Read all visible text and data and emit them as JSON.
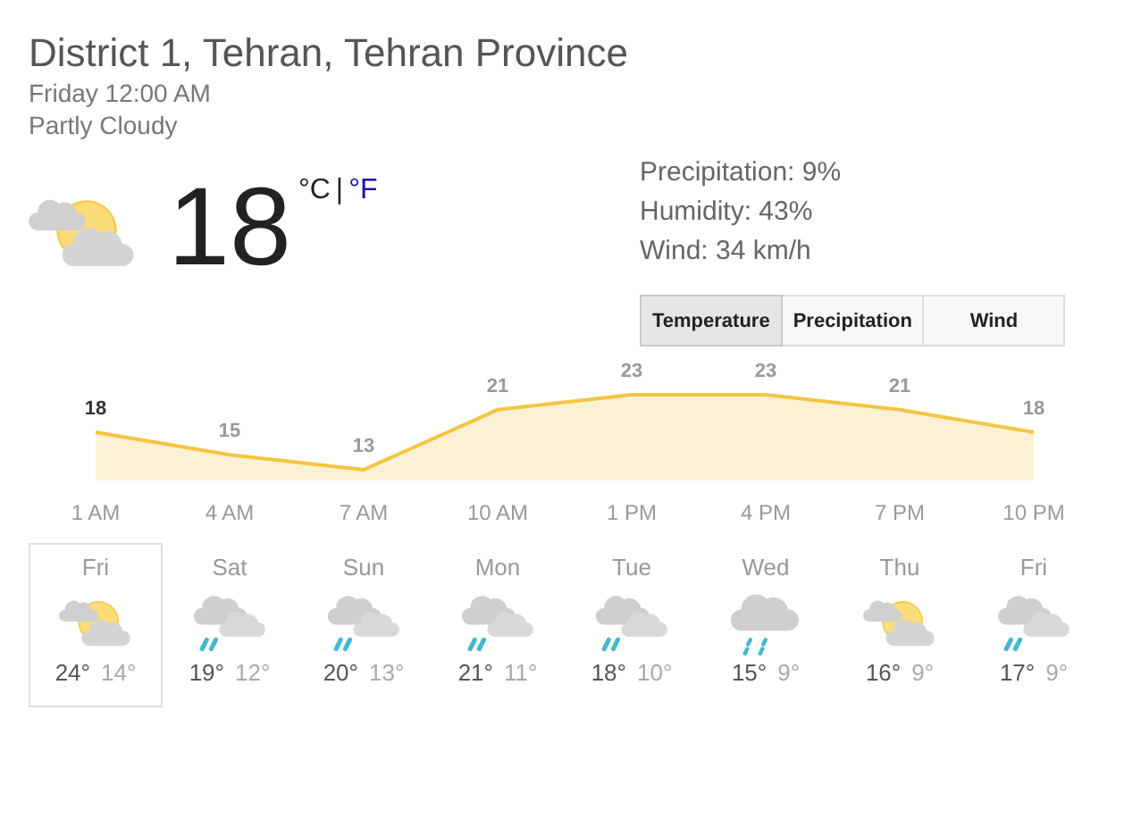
{
  "location": "District 1, Tehran, Tehran Province",
  "time": "Friday 12:00 AM",
  "condition": "Partly Cloudy",
  "current": {
    "kind": "partly_cloudy",
    "temperature": "18",
    "units": [
      {
        "label": "°C",
        "selected": true
      },
      {
        "label": "°F",
        "selected": false
      }
    ],
    "separator": "|"
  },
  "details": [
    "Precipitation: 9%",
    "Humidity: 43%",
    "Wind: 34 km/h"
  ],
  "tabs": [
    {
      "label": "Temperature",
      "selected": true
    },
    {
      "label": "Precipitation",
      "selected": false
    },
    {
      "label": "Wind",
      "selected": false
    }
  ],
  "chart_data": {
    "type": "area",
    "categories": [
      "1 AM",
      "4 AM",
      "7 AM",
      "10 AM",
      "1 PM",
      "4 PM",
      "7 PM",
      "10 PM"
    ],
    "series": [
      {
        "color": "#f4c542",
        "values": [
          18,
          15,
          13,
          21,
          23,
          23,
          21,
          18
        ]
      }
    ],
    "data_labels": true
  },
  "forecast": [
    {
      "day": "Fri",
      "kind": "partly_cloudy",
      "high": "24°",
      "low": "14°",
      "selected": true
    },
    {
      "day": "Sat",
      "kind": "rain",
      "high": "19°",
      "low": "12°",
      "selected": false
    },
    {
      "day": "Sun",
      "kind": "rain",
      "high": "20°",
      "low": "13°",
      "selected": false
    },
    {
      "day": "Mon",
      "kind": "rain",
      "high": "21°",
      "low": "11°",
      "selected": false
    },
    {
      "day": "Tue",
      "kind": "rain",
      "high": "18°",
      "low": "10°",
      "selected": false
    },
    {
      "day": "Wed",
      "kind": "showers",
      "high": "15°",
      "low": "9°",
      "selected": false
    },
    {
      "day": "Thu",
      "kind": "partly_cloudy",
      "high": "16°",
      "low": "9°",
      "selected": false
    },
    {
      "day": "Fri",
      "kind": "rain",
      "high": "17°",
      "low": "9°",
      "selected": false
    }
  ]
}
